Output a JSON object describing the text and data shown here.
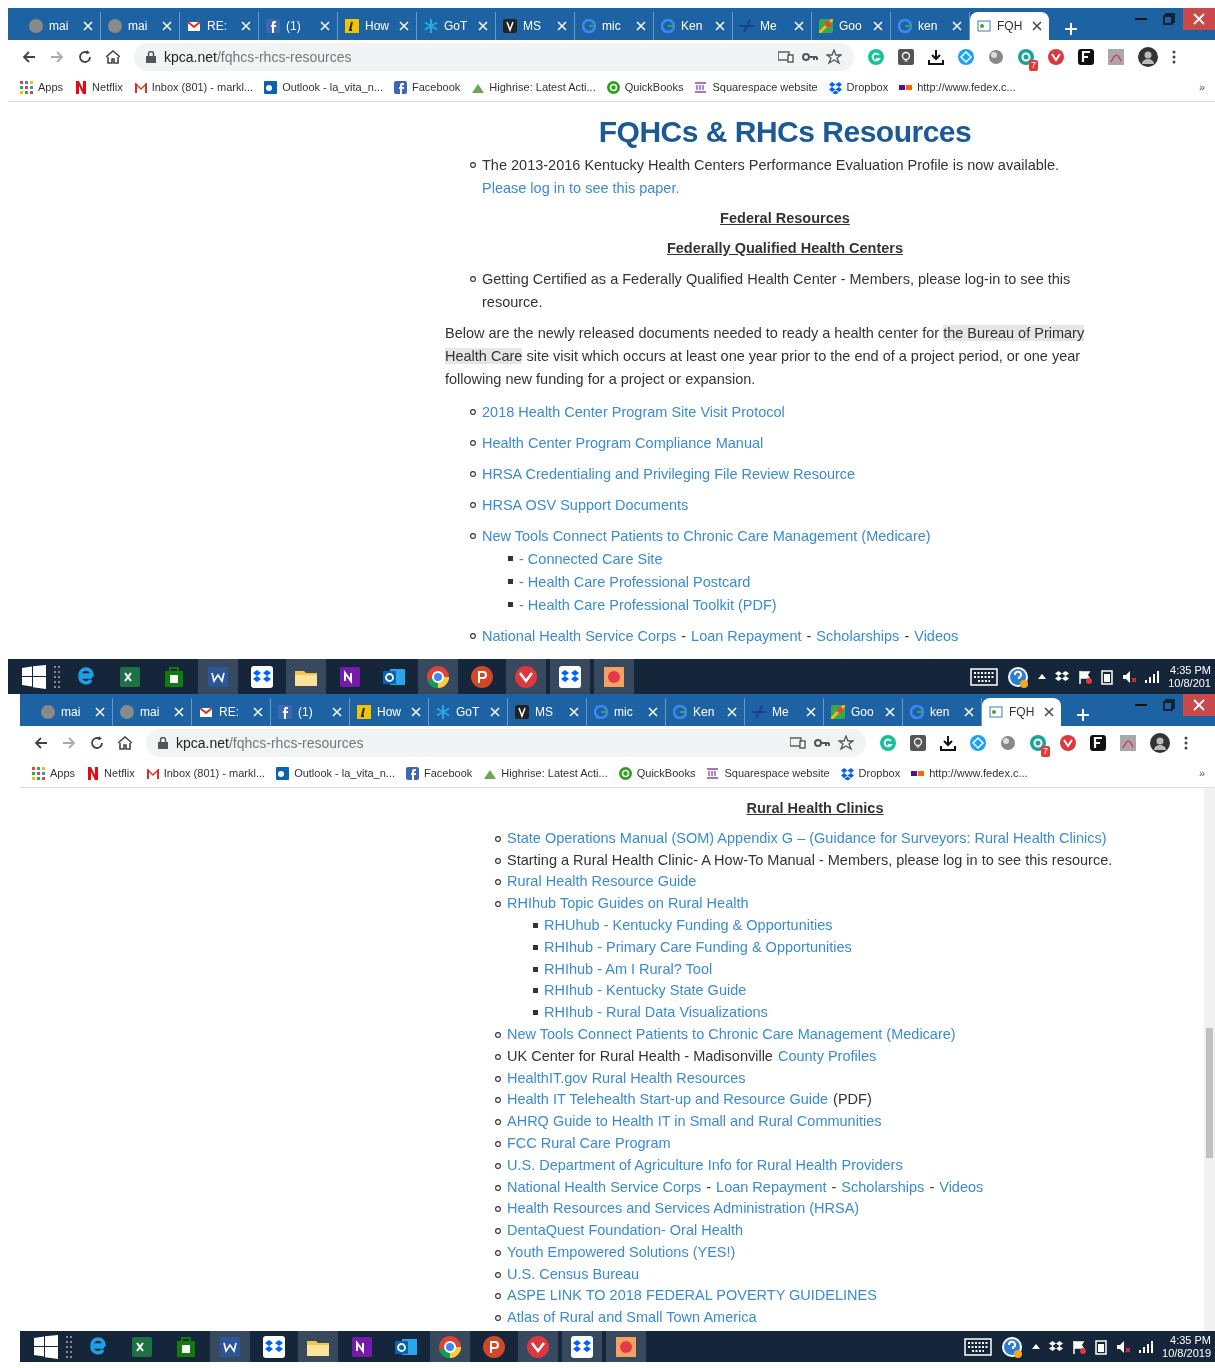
{
  "screens": [
    {
      "tabs": [
        {
          "label": "mai",
          "selected": false
        },
        {
          "label": "mai",
          "selected": false
        },
        {
          "label": "RE:",
          "selected": false
        },
        {
          "label": "(1)",
          "selected": false
        },
        {
          "label": "How",
          "selected": false
        },
        {
          "label": "GoT",
          "selected": false
        },
        {
          "label": "MS",
          "selected": false
        },
        {
          "label": "mic",
          "selected": false
        },
        {
          "label": "Ken",
          "selected": false
        },
        {
          "label": "Me",
          "selected": false
        },
        {
          "label": "Goo",
          "selected": false
        },
        {
          "label": "ken",
          "selected": false
        },
        {
          "label": "FQH",
          "selected": true
        }
      ],
      "url": {
        "host": "kpca.net",
        "path": "/fqhcs-rhcs-resources"
      },
      "extension_badge": "7",
      "bookmarks": [
        "Apps",
        "Netflix",
        "Inbox (801) - markl...",
        "Outlook - la_vita_n...",
        "Facebook",
        "Highrise: Latest Acti...",
        "QuickBooks",
        "Squarespace website",
        "Dropbox",
        "http://www.fedex.c..."
      ],
      "bookmarks_more": "»",
      "content": [
        {
          "kind": "heading",
          "text": "FQHCs & RHCs Resources"
        },
        {
          "kind": "list",
          "items": [
            {
              "segments": [
                {
                  "text": "The 2013-2016 Kentucky Health Centers Performance Evaluation Profile is now available.",
                  "link": false
                },
                {
                  "text": "Please log in to see this paper.",
                  "link": true
                }
              ]
            }
          ]
        },
        {
          "kind": "subheading",
          "text": "Federal Resources"
        },
        {
          "kind": "subheading",
          "text": "Federally Qualified Health Centers"
        },
        {
          "kind": "list",
          "items": [
            {
              "segments": [
                {
                  "text": "Getting Certified as a Federally Qualified Health Center - Members, please log-in to see this resource.",
                  "link": false
                }
              ]
            }
          ]
        },
        {
          "kind": "paragraph",
          "before": "Below are the newly released documents needed to ready a health center for",
          "highlight": "the Bureau of Primary Health Care",
          "after": "site visit which occurs at least one year prior to the end of a project period, or one year following new funding for a project or expansion."
        },
        {
          "kind": "list",
          "items": [
            {
              "segments": [
                {
                  "text": "2018 Health Center Program Site Visit Protocol",
                  "link": true
                }
              ]
            },
            {
              "segments": [
                {
                  "text": "Health Center Program Compliance Manual",
                  "link": true
                }
              ]
            },
            {
              "segments": [
                {
                  "text": "HRSA Credentialing and Privileging File Review Resource",
                  "link": true
                }
              ]
            },
            {
              "segments": [
                {
                  "text": "HRSA OSV Support Documents",
                  "link": true
                }
              ]
            },
            {
              "segments": [
                {
                  "text": "New Tools Connect Patients to Chronic Care Management (Medicare)",
                  "link": true
                }
              ],
              "children": [
                {
                  "segments": [
                    {
                      "text": "- Connected Care Site",
                      "link": true
                    }
                  ]
                },
                {
                  "segments": [
                    {
                      "text": "- Health Care Professional Postcard",
                      "link": true
                    }
                  ]
                },
                {
                  "segments": [
                    {
                      "text": "- Health Care Professional Toolkit (PDF)",
                      "link": true
                    }
                  ]
                }
              ]
            },
            {
              "segments": [
                {
                  "text": "National Health Service Corps",
                  "link": true
                },
                {
                  "text": "-",
                  "link": false
                },
                {
                  "text": "Loan Repayment",
                  "link": true
                },
                {
                  "text": "-",
                  "link": false
                },
                {
                  "text": "Scholarships",
                  "link": true
                },
                {
                  "text": "-",
                  "link": false
                },
                {
                  "text": "Videos",
                  "link": true
                }
              ]
            }
          ]
        }
      ],
      "clock": {
        "time": "4:35 PM",
        "date": "10/8/201"
      }
    },
    {
      "tabs": [
        {
          "label": "mai",
          "selected": false
        },
        {
          "label": "mai",
          "selected": false
        },
        {
          "label": "RE:",
          "selected": false
        },
        {
          "label": "(1)",
          "selected": false
        },
        {
          "label": "How",
          "selected": false
        },
        {
          "label": "GoT",
          "selected": false
        },
        {
          "label": "MS",
          "selected": false
        },
        {
          "label": "mic",
          "selected": false
        },
        {
          "label": "Ken",
          "selected": false
        },
        {
          "label": "Me",
          "selected": false
        },
        {
          "label": "Goo",
          "selected": false
        },
        {
          "label": "ken",
          "selected": false
        },
        {
          "label": "FQH",
          "selected": true
        }
      ],
      "url": {
        "host": "kpca.net",
        "path": "/fqhcs-rhcs-resources"
      },
      "extension_badge": "7",
      "bookmarks": [
        "Apps",
        "Netflix",
        "Inbox (801) - markl...",
        "Outlook - la_vita_n...",
        "Facebook",
        "Highrise: Latest Acti...",
        "QuickBooks",
        "Squarespace website",
        "Dropbox",
        "http://www.fedex.c..."
      ],
      "bookmarks_more": "»",
      "has_scrollbar": true,
      "content": [
        {
          "kind": "subheading",
          "text": "Rural Health Clinics"
        },
        {
          "kind": "list",
          "items": [
            {
              "segments": [
                {
                  "text": "State Operations Manual (SOM) Appendix G – (Guidance for Surveyors: Rural Health Clinics)",
                  "link": true
                }
              ]
            },
            {
              "segments": [
                {
                  "text": "Starting a Rural Health Clinic- A How-To Manual - Members, please log in to see this resource.",
                  "link": false
                }
              ]
            },
            {
              "segments": [
                {
                  "text": "Rural Health Resource Guide",
                  "link": true
                }
              ]
            },
            {
              "segments": [
                {
                  "text": "RHIhub Topic Guides on Rural Health",
                  "link": true
                }
              ],
              "children": [
                {
                  "segments": [
                    {
                      "text": "RHUhub - Kentucky Funding & Opportunities",
                      "link": true
                    }
                  ]
                },
                {
                  "segments": [
                    {
                      "text": "RHIhub - Primary Care Funding & Opportunities",
                      "link": true
                    }
                  ]
                },
                {
                  "segments": [
                    {
                      "text": "RHIhub - Am I Rural? Tool",
                      "link": true
                    }
                  ]
                },
                {
                  "segments": [
                    {
                      "text": "RHIhub - Kentucky State Guide",
                      "link": true
                    }
                  ]
                },
                {
                  "segments": [
                    {
                      "text": "RHIhub - Rural Data Visualizations",
                      "link": true
                    }
                  ]
                }
              ]
            },
            {
              "segments": [
                {
                  "text": "New Tools Connect Patients to Chronic Care Management (Medicare)",
                  "link": true
                }
              ]
            },
            {
              "segments": [
                {
                  "text": "UK Center for Rural Health - Madisonville",
                  "link": false
                },
                {
                  "text": "County Profiles",
                  "link": true
                }
              ]
            },
            {
              "segments": [
                {
                  "text": "HealthIT.gov Rural Health Resources",
                  "link": true
                }
              ]
            },
            {
              "segments": [
                {
                  "text": "Health IT Telehealth Start-up and Resource Guide",
                  "link": true
                },
                {
                  "text": "(PDF)",
                  "link": false
                }
              ]
            },
            {
              "segments": [
                {
                  "text": "AHRQ Guide to Health IT in Small and Rural Communities",
                  "link": true
                }
              ]
            },
            {
              "segments": [
                {
                  "text": "FCC Rural Care Program",
                  "link": true
                }
              ]
            },
            {
              "segments": [
                {
                  "text": "U.S. Department of Agriculture Info for Rural Health Providers",
                  "link": true
                }
              ]
            },
            {
              "segments": [
                {
                  "text": "National Health Service Corps",
                  "link": true
                },
                {
                  "text": "-",
                  "link": false
                },
                {
                  "text": "Loan Repayment",
                  "link": true
                },
                {
                  "text": "-",
                  "link": false
                },
                {
                  "text": "Scholarships",
                  "link": true
                },
                {
                  "text": "-",
                  "link": false
                },
                {
                  "text": "Videos",
                  "link": true
                }
              ]
            },
            {
              "segments": [
                {
                  "text": "Health Resources and Services Administration (HRSA)",
                  "link": true
                }
              ]
            },
            {
              "segments": [
                {
                  "text": "DentaQuest Foundation- Oral Health",
                  "link": true
                }
              ]
            },
            {
              "segments": [
                {
                  "text": "Youth Empowered Solutions (YES!)",
                  "link": true
                }
              ]
            },
            {
              "segments": [
                {
                  "text": "U.S. Census Bureau",
                  "link": true
                }
              ]
            },
            {
              "segments": [
                {
                  "text": "ASPE LINK TO 2018 FEDERAL POVERTY GUIDELINES",
                  "link": true
                }
              ]
            },
            {
              "segments": [
                {
                  "text": "Atlas of Rural and Small Town America",
                  "link": true
                }
              ]
            }
          ]
        }
      ],
      "clock": {
        "time": "4:35 PM",
        "date": "10/8/2019"
      }
    }
  ]
}
